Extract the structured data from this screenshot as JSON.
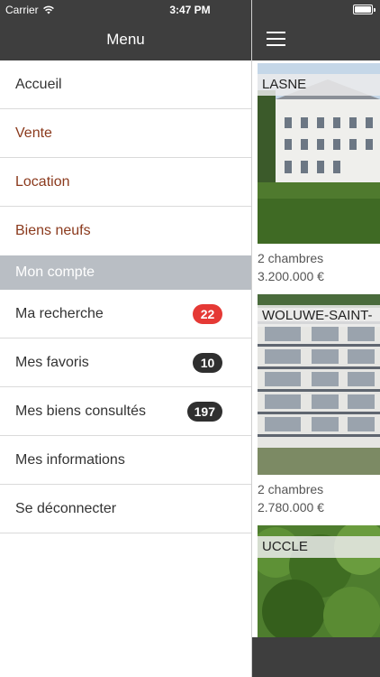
{
  "status_bar": {
    "carrier": "Carrier",
    "time": "3:47 PM"
  },
  "menu": {
    "title": "Menu",
    "items": [
      {
        "label": "Accueil",
        "accent": false
      },
      {
        "label": "Vente",
        "accent": true
      },
      {
        "label": "Location",
        "accent": true
      },
      {
        "label": "Biens neufs",
        "accent": true
      }
    ],
    "section_title": "Mon compte",
    "account_items": [
      {
        "label": "Ma recherche",
        "badge": "22",
        "badge_color": "#e53935"
      },
      {
        "label": "Mes favoris",
        "badge": "10",
        "badge_color": "#2f2f2f"
      },
      {
        "label": "Mes biens consultés",
        "badge": "197",
        "badge_color": "#2f2f2f"
      },
      {
        "label": "Mes informations"
      },
      {
        "label": "Se déconnecter"
      }
    ]
  },
  "listings": [
    {
      "city": "LASNE",
      "rooms": "2 chambres",
      "price": "3.200.000 €"
    },
    {
      "city": "WOLUWE-SAINT-",
      "rooms": "2 chambres",
      "price": "2.780.000 €"
    },
    {
      "city": "UCCLE"
    }
  ],
  "colors": {
    "header_bg": "#3e3e3e",
    "accent_text": "#8b3a1d",
    "section_bg": "#b9bec4"
  }
}
